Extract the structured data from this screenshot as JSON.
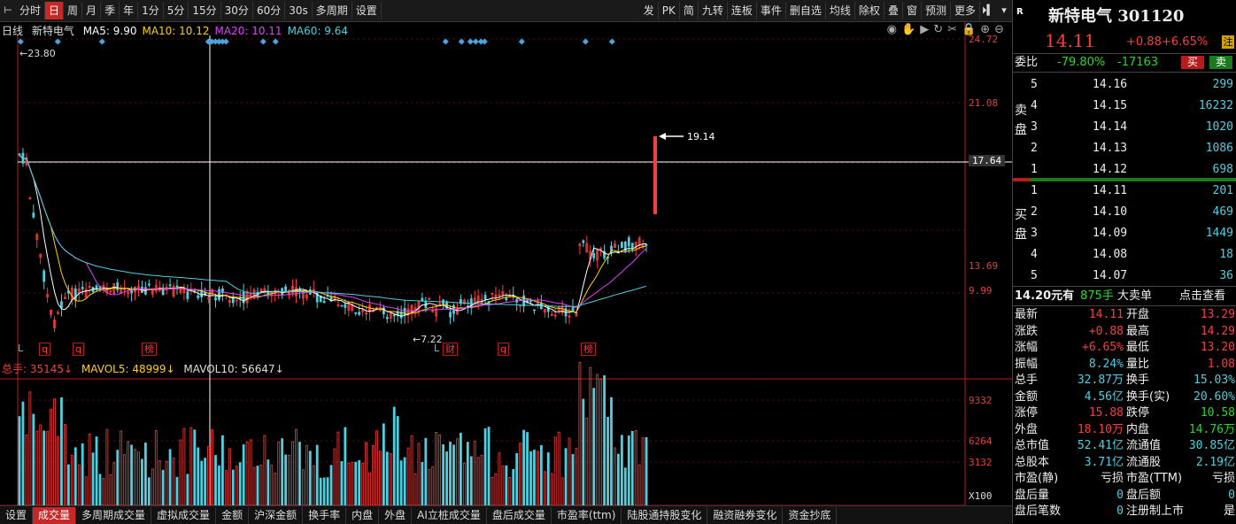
{
  "toolbar": {
    "periods": [
      "分时",
      "日",
      "周",
      "月",
      "季",
      "年",
      "1分",
      "5分",
      "15分",
      "30分",
      "60分",
      "30s",
      "多周期",
      "设置"
    ],
    "active_period": "日",
    "right_items": [
      "发",
      "PK",
      "简",
      "九转",
      "连板",
      "事件",
      "删自选",
      "均线",
      "除权",
      "叠",
      "窗",
      "预测",
      "更多"
    ]
  },
  "chart": {
    "legend_name": "日线",
    "stock_name": "新特电气",
    "ma": [
      {
        "label": "MA5: 9.90",
        "color": "#ffffff"
      },
      {
        "label": "MA10: 10.12",
        "color": "#ffd000"
      },
      {
        "label": "MA20: 10.11",
        "color": "#e040fb"
      },
      {
        "label": "MA60: 9.64",
        "color": "#4dd0e1"
      }
    ],
    "price_axis": [
      "24.72",
      "21.08",
      "17.64",
      "13.69",
      "9.99"
    ],
    "crosshair_price": "17.64",
    "high_label": "←23.80",
    "peak_label": "19.14",
    "low_label": "←7.22",
    "event_markers": [
      "L",
      "q",
      "q",
      "榜",
      "L",
      "财",
      "q",
      "榜"
    ],
    "vol_legend": {
      "total": "总手: 35145↓",
      "mavol5": "MAVOL5: 48999↓",
      "mavol10": "MAVOL10: 56647↓"
    },
    "vol_axis": [
      "9332",
      "6264",
      "3132",
      "X100"
    ]
  },
  "bottom_tabs": [
    "设置",
    "成交量",
    "多周期成交量",
    "虚拟成交量",
    "金额",
    "沪深金额",
    "换手率",
    "内盘",
    "外盘",
    "AI立桩成交量",
    "盘后成交量",
    "市盈率(ttm)",
    "陆股通持股变化",
    "融资融券变化",
    "资金抄底"
  ],
  "active_bottom_tab": "成交量",
  "panel": {
    "badge": "R",
    "title": "新特电气 301120",
    "price": "14.11",
    "change": "+0.88",
    "change_pct": "+6.65%",
    "tag": "注",
    "weibi_label": "委比",
    "weibi_pct": "-79.80%",
    "weibi_diff": "-17163",
    "buy_btn": "买",
    "sell_btn": "卖",
    "sell_label": [
      "卖",
      "盘"
    ],
    "buy_label": [
      "买",
      "盘"
    ],
    "asks": [
      {
        "level": "5",
        "price": "14.16",
        "vol": "299"
      },
      {
        "level": "4",
        "price": "14.15",
        "vol": "16232"
      },
      {
        "level": "3",
        "price": "14.14",
        "vol": "1020"
      },
      {
        "level": "2",
        "price": "14.13",
        "vol": "1086"
      },
      {
        "level": "1",
        "price": "14.12",
        "vol": "698"
      }
    ],
    "bids": [
      {
        "level": "1",
        "price": "14.11",
        "vol": "201"
      },
      {
        "level": "2",
        "price": "14.10",
        "vol": "469"
      },
      {
        "level": "3",
        "price": "14.09",
        "vol": "1449"
      },
      {
        "level": "4",
        "price": "14.08",
        "vol": "18"
      },
      {
        "level": "5",
        "price": "14.07",
        "vol": "36"
      }
    ],
    "big_order": {
      "price": "14.20元有",
      "vol": "875手",
      "label": "大卖单",
      "link": "点击查看"
    },
    "stats": [
      [
        "最新",
        "14.11",
        "red",
        "开盘",
        "13.29",
        "red"
      ],
      [
        "涨跌",
        "+0.88",
        "red",
        "最高",
        "14.29",
        "red"
      ],
      [
        "涨幅",
        "+6.65%",
        "red",
        "最低",
        "13.20",
        "red"
      ],
      [
        "振幅",
        "8.24%",
        "cyan",
        "量比",
        "1.08",
        "red"
      ],
      [
        "总手",
        "32.87万",
        "cyan",
        "换手",
        "15.03%",
        "cyan"
      ],
      [
        "金额",
        "4.56亿",
        "cyan",
        "换手(实)",
        "20.60%",
        "cyan"
      ],
      [
        "涨停",
        "15.88",
        "red",
        "跌停",
        "10.58",
        "green"
      ],
      [
        "外盘",
        "18.10万",
        "red",
        "内盘",
        "14.76万",
        "green"
      ],
      [
        "总市值",
        "52.41亿",
        "cyan",
        "流通值",
        "30.85亿",
        "cyan"
      ],
      [
        "总股本",
        "3.71亿",
        "cyan",
        "流通股",
        "2.19亿",
        "cyan"
      ],
      [
        "市盈(静)",
        "亏损",
        "white",
        "市盈(TTM)",
        "亏损",
        "white"
      ],
      [
        "盘后量",
        "0",
        "cyan",
        "盘后额",
        "0",
        "cyan"
      ],
      [
        "盘后笔数",
        "0",
        "cyan",
        "注册制上市",
        "是",
        "white"
      ]
    ]
  }
}
